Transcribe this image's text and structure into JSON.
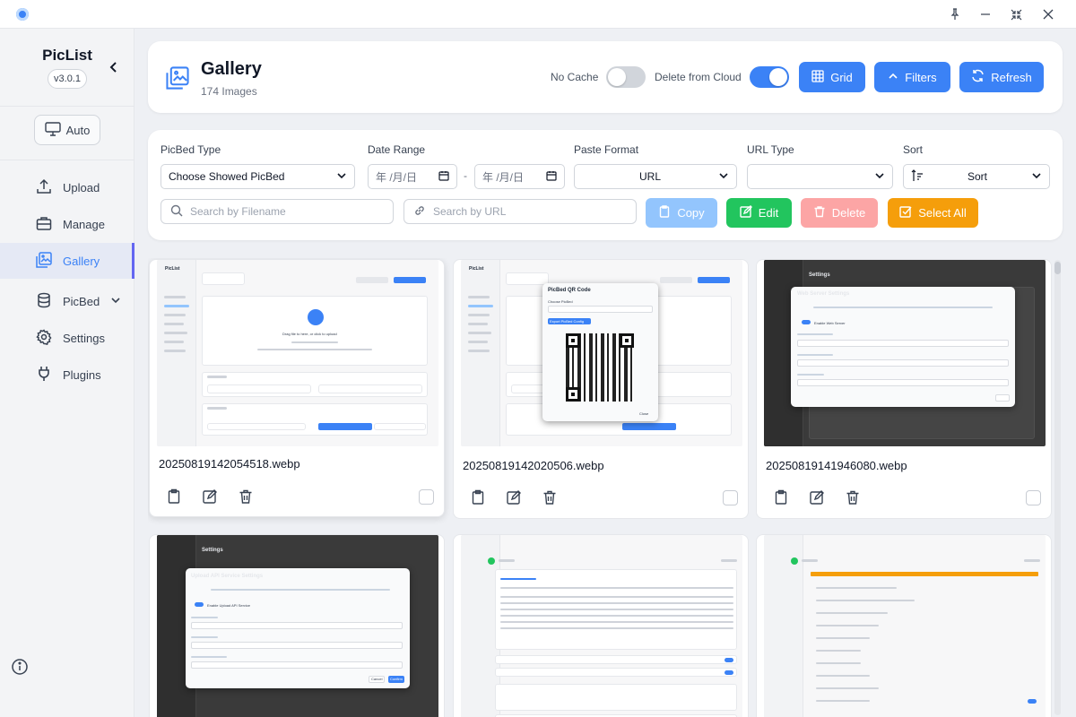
{
  "app": {
    "name": "PicList",
    "version": "v3.0.1"
  },
  "sidebar": {
    "theme_label": "Auto",
    "items": [
      {
        "label": "Upload",
        "icon": "upload-icon"
      },
      {
        "label": "Manage",
        "icon": "briefcase-icon"
      },
      {
        "label": "Gallery",
        "icon": "gallery-icon",
        "active": true
      },
      {
        "label": "PicBed",
        "icon": "database-icon",
        "expandable": true
      },
      {
        "label": "Settings",
        "icon": "gear-icon"
      },
      {
        "label": "Plugins",
        "icon": "plug-icon"
      }
    ]
  },
  "header": {
    "title": "Gallery",
    "subtitle": "174 Images",
    "no_cache_label": "No Cache",
    "no_cache_on": false,
    "delete_cloud_label": "Delete from Cloud",
    "delete_cloud_on": true,
    "grid_label": "Grid",
    "filters_label": "Filters",
    "refresh_label": "Refresh"
  },
  "filters": {
    "picbed_type_label": "PicBed Type",
    "picbed_type_value": "Choose Showed PicBed",
    "date_range_label": "Date Range",
    "date_placeholder": "年 /月/日",
    "date_separator": "-",
    "paste_format_label": "Paste Format",
    "paste_format_value": "URL",
    "url_type_label": "URL Type",
    "url_type_value": "",
    "sort_label": "Sort",
    "sort_value": "Sort",
    "search_filename_placeholder": "Search by Filename",
    "search_url_placeholder": "Search by URL",
    "copy_label": "Copy",
    "edit_label": "Edit",
    "delete_label": "Delete",
    "select_all_label": "Select All"
  },
  "gallery": {
    "items": [
      {
        "filename": "20250819142054518.webp"
      },
      {
        "filename": "20250819142020506.webp"
      },
      {
        "filename": "20250819141946080.webp"
      }
    ]
  },
  "thumbs": {
    "brand": "PicList",
    "upload_text": "Drag file to here, or click to upload",
    "qr_title": "PicBed QR Code",
    "qr_choose": "Choose PicBed",
    "qr_export": "Export PicBed Config",
    "qr_close": "Close",
    "settings_title": "Settings",
    "web_server_title": "Web Server Settings",
    "web_server_enable": "Enable Web Server",
    "api_title": "Upload API Service Settings",
    "api_enable": "Enable Upload API Service",
    "api_cancel": "Cancel",
    "api_confirm": "Confirm"
  },
  "colors": {
    "accent": "#3b82f6",
    "copy_disabled": "#93c5fd",
    "edit": "#22c55e",
    "delete_disabled": "#fca5a5",
    "select_all": "#f59e0b"
  }
}
